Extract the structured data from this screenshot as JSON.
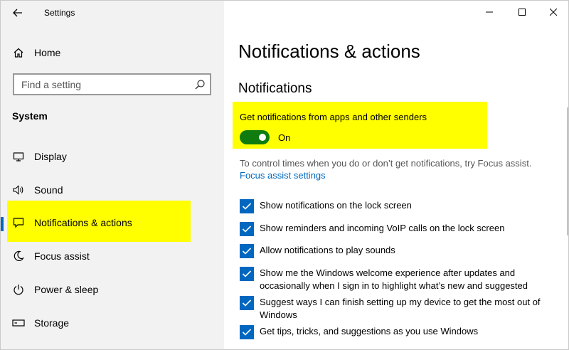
{
  "window": {
    "title": "Settings"
  },
  "nav": {
    "home": "Home",
    "search_placeholder": "Find a setting",
    "section": "System",
    "items": [
      {
        "label": "Display",
        "icon": "display-icon"
      },
      {
        "label": "Sound",
        "icon": "sound-icon"
      },
      {
        "label": "Notifications & actions",
        "icon": "notifications-icon",
        "selected": true
      },
      {
        "label": "Focus assist",
        "icon": "moon-icon"
      },
      {
        "label": "Power & sleep",
        "icon": "power-icon"
      },
      {
        "label": "Storage",
        "icon": "storage-icon"
      }
    ]
  },
  "main": {
    "title": "Notifications & actions",
    "section": "Notifications",
    "toggle": {
      "label": "Get notifications from apps and other senders",
      "state": "On",
      "on": true
    },
    "hint": "To control times when you do or don’t get notifications, try Focus assist.",
    "link": "Focus assist settings",
    "checkboxes": [
      {
        "label": "Show notifications on the lock screen",
        "checked": true
      },
      {
        "label": "Show reminders and incoming VoIP calls on the lock screen",
        "checked": true
      },
      {
        "label": "Allow notifications to play sounds",
        "checked": true
      },
      {
        "label": "Show me the Windows welcome experience after updates and occasionally when I sign in to highlight what’s new and suggested",
        "checked": true
      },
      {
        "label": "Suggest ways I can finish setting up my device to get the most out of Windows",
        "checked": true
      },
      {
        "label": "Get tips, tricks, and suggestions as you use Windows",
        "checked": true
      }
    ]
  },
  "colors": {
    "accent": "#0067c0",
    "toggle_on": "#107c10",
    "highlight": "#ffff00",
    "nav_bg": "#f2f2f2"
  }
}
